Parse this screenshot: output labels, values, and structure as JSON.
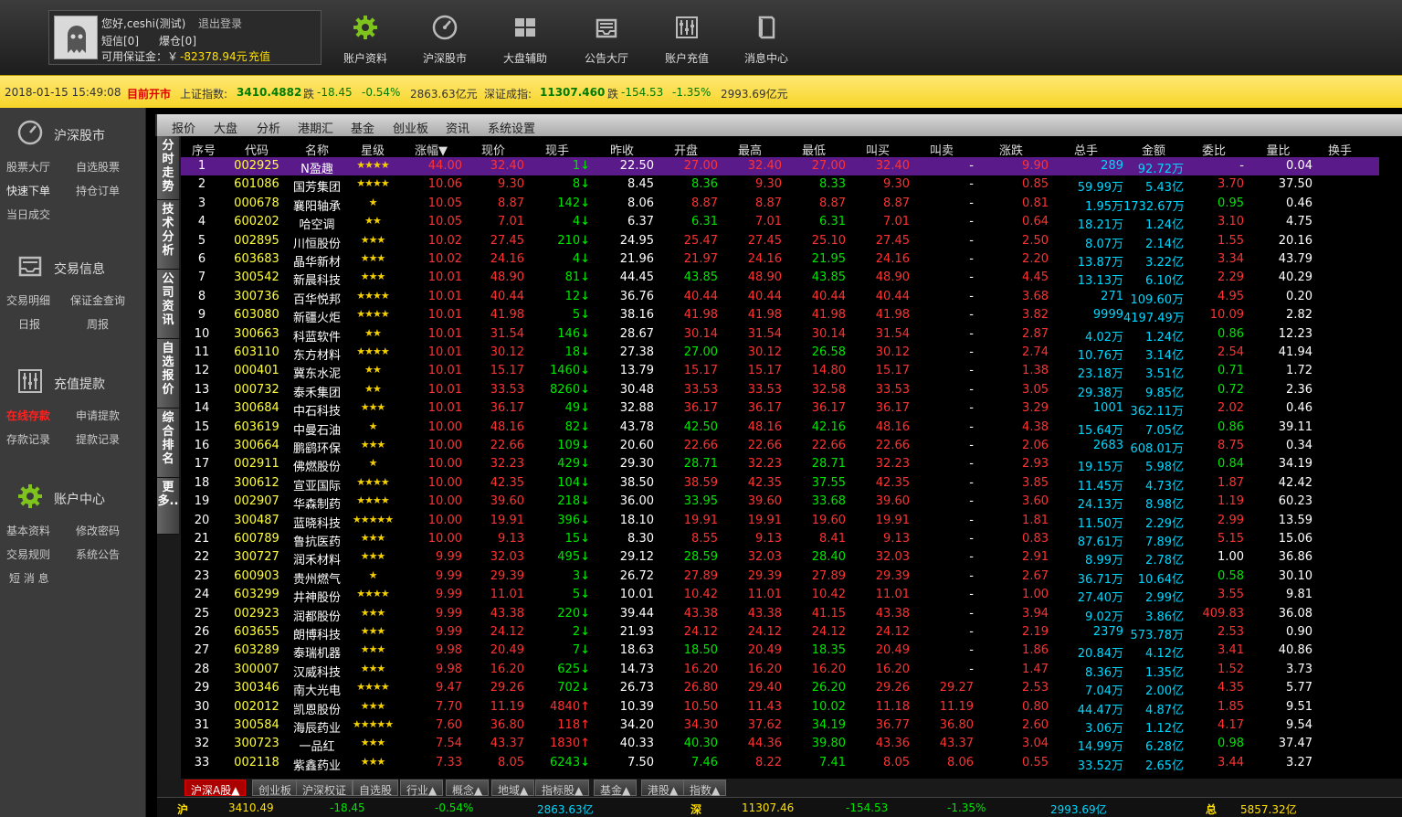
{
  "user": {
    "greeting": "您好,ceshi(测试)",
    "logout": "退出登录",
    "sms": "短信[0]",
    "liquidation": "爆仓[0]",
    "margin_label": "可用保证金：￥",
    "margin_value": "-82378.94元",
    "recharge": "充值"
  },
  "nav": [
    {
      "label": "账户资料",
      "icon": "gear-icon"
    },
    {
      "label": "沪深股市",
      "icon": "gauge-icon"
    },
    {
      "label": "大盘辅助",
      "icon": "grid-icon"
    },
    {
      "label": "公告大厅",
      "icon": "tray-icon"
    },
    {
      "label": "账户充值",
      "icon": "sliders-icon"
    },
    {
      "label": "消息中心",
      "icon": "book-icon"
    }
  ],
  "ticker": {
    "datetime": "2018-01-15 15:49:08",
    "status": "目前开市",
    "sh_label": "上证指数:",
    "sh_value": "3410.4882",
    "sh_dir": "跌",
    "sh_change": "-18.45",
    "sh_pct": "-0.54%",
    "sh_turnover": "2863.63亿元",
    "sz_label": "深证成指:",
    "sz_value": "11307.460",
    "sz_dir": "跌",
    "sz_change": "-154.53",
    "sz_pct": "-1.35%",
    "sz_turnover": "2993.69亿元"
  },
  "sidebar": {
    "sections": [
      {
        "title": "沪深股市",
        "icon": "gauge-icon",
        "items": [
          "股票大厅",
          "自选股票",
          "快速下单",
          "持仓订单",
          "当日成交"
        ]
      },
      {
        "title": "交易信息",
        "icon": "tray-icon",
        "items": [
          "交易明细",
          "保证金查询",
          "日报",
          "周报"
        ]
      },
      {
        "title": "充值提款",
        "icon": "sliders-icon",
        "items": [
          "在线存款",
          "申请提款",
          "存款记录",
          "提款记录"
        ]
      },
      {
        "title": "账户中心",
        "icon": "gear-icon",
        "items": [
          "基本资料",
          "修改密码",
          "交易规则",
          "系统公告",
          "短 消 息"
        ]
      }
    ]
  },
  "tabs": [
    "报价",
    "大盘",
    "分析",
    "港期汇",
    "基金",
    "创业板",
    "资讯",
    "系统设置"
  ],
  "vtabs": [
    "分时走势",
    "技术分析",
    "公司资讯",
    "自选报价",
    "综合排名",
    "更多.."
  ],
  "columns": [
    "序号",
    "代码",
    "名称",
    "星级",
    "涨幅▼",
    "现价",
    "现手",
    "昨收",
    "开盘",
    "最高",
    "最低",
    "叫买",
    "叫卖",
    "涨跌",
    "总手",
    "金额",
    "委比",
    "量比",
    "换手"
  ],
  "rows": [
    [
      "1",
      "002925",
      "N盈趣",
      "★★★★",
      "44.00",
      "32.40",
      "1↓",
      "22.50",
      "27.00",
      "32.40",
      "27.00",
      "32.40",
      "-",
      "9.90",
      "289",
      "92.72万",
      "-",
      "0.04"
    ],
    [
      "2",
      "601086",
      "国芳集团",
      "★★★★",
      "10.06",
      "9.30",
      "8↓",
      "8.45",
      "8.36",
      "9.30",
      "8.33",
      "9.30",
      "-",
      "0.85",
      "59.99万",
      "5.43亿",
      "3.70",
      "37.50"
    ],
    [
      "3",
      "000678",
      "襄阳轴承",
      "★",
      "10.05",
      "8.87",
      "142↓",
      "8.06",
      "8.87",
      "8.87",
      "8.87",
      "8.87",
      "-",
      "0.81",
      "1.95万",
      "1732.67万",
      "0.95",
      "0.46"
    ],
    [
      "4",
      "600202",
      "哈空调",
      "★★",
      "10.05",
      "7.01",
      "4↓",
      "6.37",
      "6.31",
      "7.01",
      "6.31",
      "7.01",
      "-",
      "0.64",
      "18.21万",
      "1.24亿",
      "3.10",
      "4.75"
    ],
    [
      "5",
      "002895",
      "川恒股份",
      "★★★",
      "10.02",
      "27.45",
      "210↓",
      "24.95",
      "25.47",
      "27.45",
      "25.10",
      "27.45",
      "-",
      "2.50",
      "8.07万",
      "2.14亿",
      "1.55",
      "20.16"
    ],
    [
      "6",
      "603683",
      "晶华新材",
      "★★★",
      "10.02",
      "24.16",
      "4↓",
      "21.96",
      "21.97",
      "24.16",
      "21.95",
      "24.16",
      "-",
      "2.20",
      "13.87万",
      "3.22亿",
      "3.34",
      "43.79"
    ],
    [
      "7",
      "300542",
      "新晨科技",
      "★★★",
      "10.01",
      "48.90",
      "81↓",
      "44.45",
      "43.85",
      "48.90",
      "43.85",
      "48.90",
      "-",
      "4.45",
      "13.13万",
      "6.10亿",
      "2.29",
      "40.29"
    ],
    [
      "8",
      "300736",
      "百华悦邦",
      "★★★★",
      "10.01",
      "40.44",
      "12↓",
      "36.76",
      "40.44",
      "40.44",
      "40.44",
      "40.44",
      "-",
      "3.68",
      "271",
      "109.60万",
      "4.95",
      "0.20"
    ],
    [
      "9",
      "603080",
      "新疆火炬",
      "★★★★",
      "10.01",
      "41.98",
      "5↓",
      "38.16",
      "41.98",
      "41.98",
      "41.98",
      "41.98",
      "-",
      "3.82",
      "9999",
      "4197.49万",
      "10.09",
      "2.82"
    ],
    [
      "10",
      "300663",
      "科蓝软件",
      "★★",
      "10.01",
      "31.54",
      "146↓",
      "28.67",
      "30.14",
      "31.54",
      "30.14",
      "31.54",
      "-",
      "2.87",
      "4.02万",
      "1.24亿",
      "0.86",
      "12.23"
    ],
    [
      "11",
      "603110",
      "东方材料",
      "★★★★",
      "10.01",
      "30.12",
      "18↓",
      "27.38",
      "27.00",
      "30.12",
      "26.58",
      "30.12",
      "-",
      "2.74",
      "10.76万",
      "3.14亿",
      "2.54",
      "41.94"
    ],
    [
      "12",
      "000401",
      "冀东水泥",
      "★★",
      "10.01",
      "15.17",
      "1460↓",
      "13.79",
      "15.17",
      "15.17",
      "14.80",
      "15.17",
      "-",
      "1.38",
      "23.18万",
      "3.51亿",
      "0.71",
      "1.72"
    ],
    [
      "13",
      "000732",
      "泰禾集团",
      "★★",
      "10.01",
      "33.53",
      "8260↓",
      "30.48",
      "33.53",
      "33.53",
      "32.58",
      "33.53",
      "-",
      "3.05",
      "29.38万",
      "9.85亿",
      "0.72",
      "2.36"
    ],
    [
      "14",
      "300684",
      "中石科技",
      "★★★",
      "10.01",
      "36.17",
      "49↓",
      "32.88",
      "36.17",
      "36.17",
      "36.17",
      "36.17",
      "-",
      "3.29",
      "1001",
      "362.11万",
      "2.02",
      "0.46"
    ],
    [
      "15",
      "603619",
      "中曼石油",
      "★",
      "10.00",
      "48.16",
      "82↓",
      "43.78",
      "42.50",
      "48.16",
      "42.16",
      "48.16",
      "-",
      "4.38",
      "15.64万",
      "7.05亿",
      "0.86",
      "39.11"
    ],
    [
      "16",
      "300664",
      "鹏鹞环保",
      "★★★",
      "10.00",
      "22.66",
      "109↓",
      "20.60",
      "22.66",
      "22.66",
      "22.66",
      "22.66",
      "-",
      "2.06",
      "2683",
      "608.01万",
      "8.75",
      "0.34"
    ],
    [
      "17",
      "002911",
      "佛燃股份",
      "★",
      "10.00",
      "32.23",
      "429↓",
      "29.30",
      "28.71",
      "32.23",
      "28.71",
      "32.23",
      "-",
      "2.93",
      "19.15万",
      "5.98亿",
      "0.84",
      "34.19"
    ],
    [
      "18",
      "300612",
      "宣亚国际",
      "★★★★",
      "10.00",
      "42.35",
      "104↓",
      "38.50",
      "38.59",
      "42.35",
      "37.55",
      "42.35",
      "-",
      "3.85",
      "11.45万",
      "4.73亿",
      "1.87",
      "42.42"
    ],
    [
      "19",
      "002907",
      "华森制药",
      "★★★★",
      "10.00",
      "39.60",
      "218↓",
      "36.00",
      "33.95",
      "39.60",
      "33.68",
      "39.60",
      "-",
      "3.60",
      "24.13万",
      "8.98亿",
      "1.19",
      "60.23"
    ],
    [
      "20",
      "300487",
      "蓝晓科技",
      "★★★★★",
      "10.00",
      "19.91",
      "396↓",
      "18.10",
      "19.91",
      "19.91",
      "19.60",
      "19.91",
      "-",
      "1.81",
      "11.50万",
      "2.29亿",
      "2.99",
      "13.59"
    ],
    [
      "21",
      "600789",
      "鲁抗医药",
      "★★★",
      "10.00",
      "9.13",
      "15↓",
      "8.30",
      "8.55",
      "9.13",
      "8.41",
      "9.13",
      "-",
      "0.83",
      "87.61万",
      "7.89亿",
      "5.15",
      "15.06"
    ],
    [
      "22",
      "300727",
      "润禾材料",
      "★★★",
      "9.99",
      "32.03",
      "495↓",
      "29.12",
      "28.59",
      "32.03",
      "28.40",
      "32.03",
      "-",
      "2.91",
      "8.99万",
      "2.78亿",
      "1.00",
      "36.86"
    ],
    [
      "23",
      "600903",
      "贵州燃气",
      "★",
      "9.99",
      "29.39",
      "3↓",
      "26.72",
      "27.89",
      "29.39",
      "27.89",
      "29.39",
      "-",
      "2.67",
      "36.71万",
      "10.64亿",
      "0.58",
      "30.10"
    ],
    [
      "24",
      "603299",
      "井神股份",
      "★★★★",
      "9.99",
      "11.01",
      "5↓",
      "10.01",
      "10.42",
      "11.01",
      "10.42",
      "11.01",
      "-",
      "1.00",
      "27.40万",
      "2.99亿",
      "3.55",
      "9.81"
    ],
    [
      "25",
      "002923",
      "润都股份",
      "★★★",
      "9.99",
      "43.38",
      "220↓",
      "39.44",
      "43.38",
      "43.38",
      "41.15",
      "43.38",
      "-",
      "3.94",
      "9.02万",
      "3.86亿",
      "409.83",
      "36.08"
    ],
    [
      "26",
      "603655",
      "朗博科技",
      "★★★",
      "9.99",
      "24.12",
      "2↓",
      "21.93",
      "24.12",
      "24.12",
      "24.12",
      "24.12",
      "-",
      "2.19",
      "2379",
      "573.78万",
      "2.53",
      "0.90"
    ],
    [
      "27",
      "603289",
      "泰瑞机器",
      "★★★",
      "9.98",
      "20.49",
      "7↓",
      "18.63",
      "18.50",
      "20.49",
      "18.35",
      "20.49",
      "-",
      "1.86",
      "20.84万",
      "4.12亿",
      "3.41",
      "40.86"
    ],
    [
      "28",
      "300007",
      "汉威科技",
      "★★★",
      "9.98",
      "16.20",
      "625↓",
      "14.73",
      "16.20",
      "16.20",
      "16.20",
      "16.20",
      "-",
      "1.47",
      "8.36万",
      "1.35亿",
      "1.52",
      "3.73"
    ],
    [
      "29",
      "300346",
      "南大光电",
      "★★★★",
      "9.47",
      "29.26",
      "702↓",
      "26.73",
      "26.80",
      "29.40",
      "26.20",
      "29.26",
      "29.27",
      "2.53",
      "7.04万",
      "2.00亿",
      "4.35",
      "5.77"
    ],
    [
      "30",
      "002012",
      "凯恩股份",
      "★★★",
      "7.70",
      "11.19",
      "4840↑",
      "10.39",
      "10.50",
      "11.43",
      "10.02",
      "11.18",
      "11.19",
      "0.80",
      "44.47万",
      "4.87亿",
      "1.85",
      "9.51"
    ],
    [
      "31",
      "300584",
      "海辰药业",
      "★★★★★",
      "7.60",
      "36.80",
      "118↑",
      "34.20",
      "34.30",
      "37.62",
      "34.19",
      "36.77",
      "36.80",
      "2.60",
      "3.06万",
      "1.12亿",
      "4.17",
      "9.54"
    ],
    [
      "32",
      "300723",
      "一品红",
      "★★★",
      "7.54",
      "43.37",
      "1830↑",
      "40.33",
      "40.30",
      "44.36",
      "39.80",
      "43.36",
      "43.37",
      "3.04",
      "14.99万",
      "6.28亿",
      "0.98",
      "37.47"
    ],
    [
      "33",
      "002118",
      "紫鑫药业",
      "★★★",
      "7.33",
      "8.05",
      "6243↓",
      "7.50",
      "7.46",
      "8.22",
      "7.41",
      "8.05",
      "8.06",
      "0.55",
      "33.52万",
      "2.65亿",
      "3.44",
      "3.27"
    ]
  ],
  "bottom_tabs": [
    "沪深A股▲",
    "创业板",
    "沪深权证",
    "自选股",
    "行业▲",
    "概念▲",
    "地域▲",
    "指标股▲",
    "基金▲",
    "港股▲",
    "指数▲"
  ],
  "footer": {
    "sh_mark": "沪",
    "sh_value": "3410.49",
    "sh_change": "-18.45",
    "sh_pct": "-0.54%",
    "sh_turnover": "2863.63亿",
    "sz_mark": "深",
    "sz_value": "11307.46",
    "sz_change": "-154.53",
    "sz_pct": "-1.35%",
    "sz_turnover": "2993.69亿",
    "total_mark": "总",
    "total_value": "5857.32亿"
  },
  "colors": {
    "ticker_bg": "#f6d528",
    "selected_row": "#5a1a8a",
    "up": "#ff3232",
    "down": "#00e600",
    "volume": "#00d8ff"
  }
}
